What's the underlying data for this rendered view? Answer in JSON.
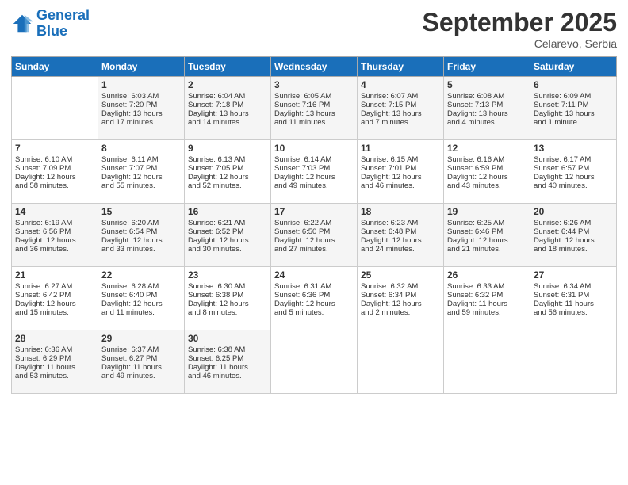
{
  "header": {
    "logo_line1": "General",
    "logo_line2": "Blue",
    "month": "September 2025",
    "location": "Celarevo, Serbia"
  },
  "weekdays": [
    "Sunday",
    "Monday",
    "Tuesday",
    "Wednesday",
    "Thursday",
    "Friday",
    "Saturday"
  ],
  "weeks": [
    [
      {
        "day": "",
        "info": ""
      },
      {
        "day": "1",
        "info": "Sunrise: 6:03 AM\nSunset: 7:20 PM\nDaylight: 13 hours\nand 17 minutes."
      },
      {
        "day": "2",
        "info": "Sunrise: 6:04 AM\nSunset: 7:18 PM\nDaylight: 13 hours\nand 14 minutes."
      },
      {
        "day": "3",
        "info": "Sunrise: 6:05 AM\nSunset: 7:16 PM\nDaylight: 13 hours\nand 11 minutes."
      },
      {
        "day": "4",
        "info": "Sunrise: 6:07 AM\nSunset: 7:15 PM\nDaylight: 13 hours\nand 7 minutes."
      },
      {
        "day": "5",
        "info": "Sunrise: 6:08 AM\nSunset: 7:13 PM\nDaylight: 13 hours\nand 4 minutes."
      },
      {
        "day": "6",
        "info": "Sunrise: 6:09 AM\nSunset: 7:11 PM\nDaylight: 13 hours\nand 1 minute."
      }
    ],
    [
      {
        "day": "7",
        "info": "Sunrise: 6:10 AM\nSunset: 7:09 PM\nDaylight: 12 hours\nand 58 minutes."
      },
      {
        "day": "8",
        "info": "Sunrise: 6:11 AM\nSunset: 7:07 PM\nDaylight: 12 hours\nand 55 minutes."
      },
      {
        "day": "9",
        "info": "Sunrise: 6:13 AM\nSunset: 7:05 PM\nDaylight: 12 hours\nand 52 minutes."
      },
      {
        "day": "10",
        "info": "Sunrise: 6:14 AM\nSunset: 7:03 PM\nDaylight: 12 hours\nand 49 minutes."
      },
      {
        "day": "11",
        "info": "Sunrise: 6:15 AM\nSunset: 7:01 PM\nDaylight: 12 hours\nand 46 minutes."
      },
      {
        "day": "12",
        "info": "Sunrise: 6:16 AM\nSunset: 6:59 PM\nDaylight: 12 hours\nand 43 minutes."
      },
      {
        "day": "13",
        "info": "Sunrise: 6:17 AM\nSunset: 6:57 PM\nDaylight: 12 hours\nand 40 minutes."
      }
    ],
    [
      {
        "day": "14",
        "info": "Sunrise: 6:19 AM\nSunset: 6:56 PM\nDaylight: 12 hours\nand 36 minutes."
      },
      {
        "day": "15",
        "info": "Sunrise: 6:20 AM\nSunset: 6:54 PM\nDaylight: 12 hours\nand 33 minutes."
      },
      {
        "day": "16",
        "info": "Sunrise: 6:21 AM\nSunset: 6:52 PM\nDaylight: 12 hours\nand 30 minutes."
      },
      {
        "day": "17",
        "info": "Sunrise: 6:22 AM\nSunset: 6:50 PM\nDaylight: 12 hours\nand 27 minutes."
      },
      {
        "day": "18",
        "info": "Sunrise: 6:23 AM\nSunset: 6:48 PM\nDaylight: 12 hours\nand 24 minutes."
      },
      {
        "day": "19",
        "info": "Sunrise: 6:25 AM\nSunset: 6:46 PM\nDaylight: 12 hours\nand 21 minutes."
      },
      {
        "day": "20",
        "info": "Sunrise: 6:26 AM\nSunset: 6:44 PM\nDaylight: 12 hours\nand 18 minutes."
      }
    ],
    [
      {
        "day": "21",
        "info": "Sunrise: 6:27 AM\nSunset: 6:42 PM\nDaylight: 12 hours\nand 15 minutes."
      },
      {
        "day": "22",
        "info": "Sunrise: 6:28 AM\nSunset: 6:40 PM\nDaylight: 12 hours\nand 11 minutes."
      },
      {
        "day": "23",
        "info": "Sunrise: 6:30 AM\nSunset: 6:38 PM\nDaylight: 12 hours\nand 8 minutes."
      },
      {
        "day": "24",
        "info": "Sunrise: 6:31 AM\nSunset: 6:36 PM\nDaylight: 12 hours\nand 5 minutes."
      },
      {
        "day": "25",
        "info": "Sunrise: 6:32 AM\nSunset: 6:34 PM\nDaylight: 12 hours\nand 2 minutes."
      },
      {
        "day": "26",
        "info": "Sunrise: 6:33 AM\nSunset: 6:32 PM\nDaylight: 11 hours\nand 59 minutes."
      },
      {
        "day": "27",
        "info": "Sunrise: 6:34 AM\nSunset: 6:31 PM\nDaylight: 11 hours\nand 56 minutes."
      }
    ],
    [
      {
        "day": "28",
        "info": "Sunrise: 6:36 AM\nSunset: 6:29 PM\nDaylight: 11 hours\nand 53 minutes."
      },
      {
        "day": "29",
        "info": "Sunrise: 6:37 AM\nSunset: 6:27 PM\nDaylight: 11 hours\nand 49 minutes."
      },
      {
        "day": "30",
        "info": "Sunrise: 6:38 AM\nSunset: 6:25 PM\nDaylight: 11 hours\nand 46 minutes."
      },
      {
        "day": "",
        "info": ""
      },
      {
        "day": "",
        "info": ""
      },
      {
        "day": "",
        "info": ""
      },
      {
        "day": "",
        "info": ""
      }
    ]
  ]
}
